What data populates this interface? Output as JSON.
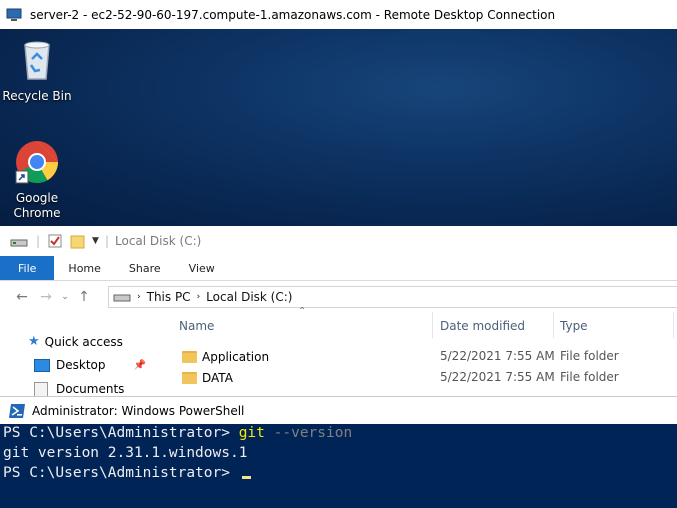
{
  "rdp": {
    "title": "server-2 - ec2-52-90-60-197.compute-1.amazonaws.com - Remote Desktop Connection"
  },
  "desktop": {
    "icons": [
      {
        "label": "Recycle Bin",
        "icon": "recycle-bin-icon"
      },
      {
        "label": "Google Chrome",
        "label_line1": "Google",
        "label_line2": "Chrome",
        "icon": "chrome-icon"
      }
    ]
  },
  "explorer": {
    "title": "Local Disk (C:)",
    "ribbon_tabs": [
      "File",
      "Home",
      "Share",
      "View"
    ],
    "breadcrumb": [
      "This PC",
      "Local Disk (C:)"
    ],
    "columns": [
      "Name",
      "Date modified",
      "Type"
    ],
    "sidebar": [
      {
        "label": "Quick access",
        "icon": "star-icon"
      },
      {
        "label": "Desktop",
        "icon": "desktop-icon"
      },
      {
        "label": "Documents",
        "icon": "documents-icon"
      }
    ],
    "rows": [
      {
        "name": "Application",
        "date": "5/22/2021 7:55 AM",
        "type": "File folder"
      },
      {
        "name": "DATA",
        "date": "5/22/2021 7:55 AM",
        "type": "File folder"
      }
    ]
  },
  "powershell": {
    "title": "Administrator: Windows PowerShell",
    "line1_prompt": "PS C:\\Users\\Administrator> ",
    "line1_cmd": "git",
    "line1_arg": " --version",
    "line2": "git version 2.31.1.windows.1",
    "line3_prompt": "PS C:\\Users\\Administrator> "
  },
  "colors": {
    "ps_background": "#012456",
    "file_tab": "#1a6fc7",
    "cmd": "#f5e900"
  }
}
